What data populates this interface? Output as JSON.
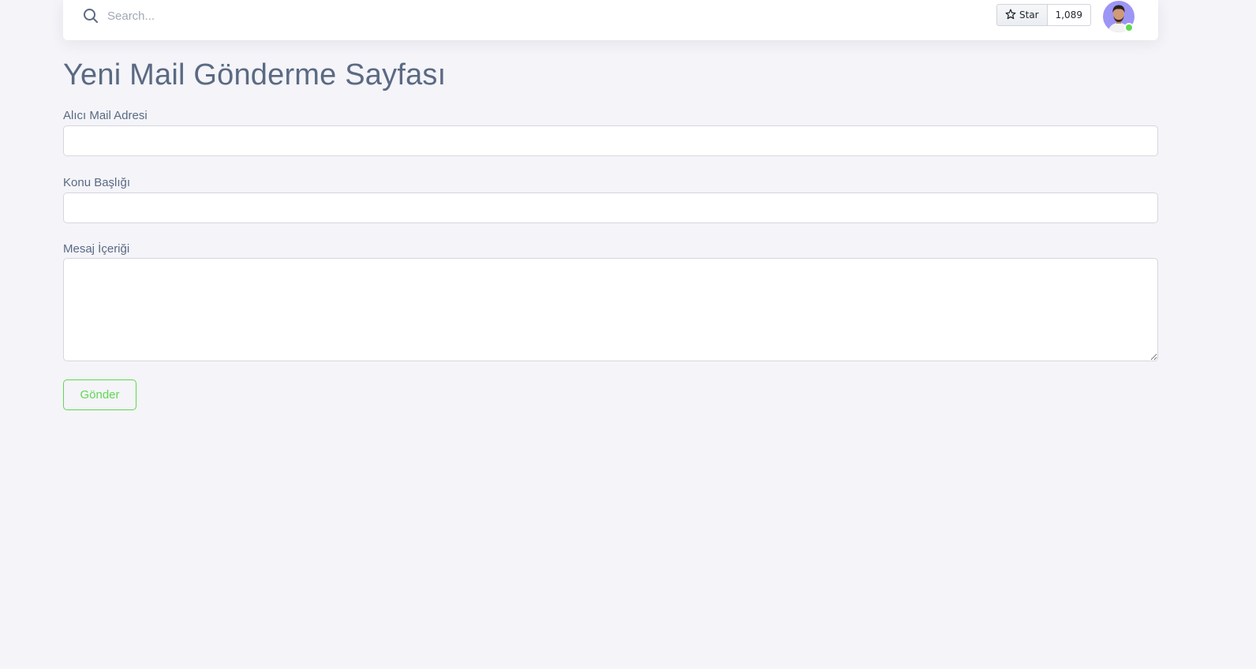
{
  "navbar": {
    "search": {
      "placeholder": "Search..."
    },
    "github": {
      "star_label": "Star",
      "star_count": "1,089"
    },
    "user": {
      "status": "online",
      "status_color": "#5fd84f"
    }
  },
  "page": {
    "title": "Yeni Mail Gönderme Sayfası"
  },
  "form": {
    "recipient": {
      "label": "Alıcı Mail Adresi",
      "value": ""
    },
    "subject": {
      "label": "Konu Başlığı",
      "value": ""
    },
    "message": {
      "label": "Mesaj İçeriği",
      "value": ""
    },
    "submit_label": "Gönder"
  },
  "colors": {
    "background": "#f4f4f9",
    "text": "#5a6a82",
    "success": "#5fd84f",
    "avatar_bg": "#7367f0"
  }
}
